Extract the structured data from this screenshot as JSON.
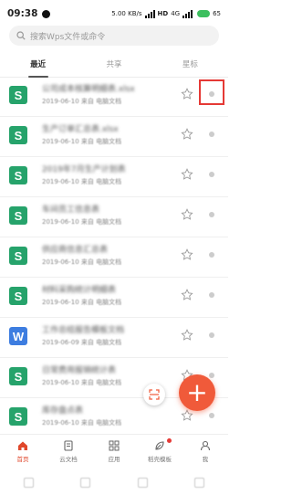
{
  "status_bar": {
    "time": "09:38",
    "network": "5.00 KB/s",
    "hd": "HD",
    "indicator": "4G",
    "battery": "65"
  },
  "search": {
    "placeholder": "搜索Wps文件或命令"
  },
  "tabs": [
    {
      "label": "最近",
      "active": true
    },
    {
      "label": "共享",
      "active": false
    },
    {
      "label": "星标",
      "active": false
    }
  ],
  "files": [
    {
      "type": "S",
      "name": "公司成本核算明细表.xlsx",
      "date": "2019-06-10",
      "meta": "来自 电脑文档"
    },
    {
      "type": "S",
      "name": "生产订单汇总表.xlsx",
      "date": "2019-06-10",
      "meta": "来自 电脑文档"
    },
    {
      "type": "S",
      "name": "2019年7月生产计划表",
      "date": "2019-06-10",
      "meta": "来自 电脑文档"
    },
    {
      "type": "S",
      "name": "车间员工信息表",
      "date": "2019-06-10",
      "meta": "来自 电脑文档"
    },
    {
      "type": "S",
      "name": "供应商信息汇总表",
      "date": "2019-06-10",
      "meta": "来自 电脑文档"
    },
    {
      "type": "S",
      "name": "材料采购统计明细表",
      "date": "2019-06-10",
      "meta": "来自 电脑文档"
    },
    {
      "type": "W",
      "name": "工作总结报告模板文档",
      "date": "2019-06-09",
      "meta": "来自 电脑文档"
    },
    {
      "type": "S",
      "name": "日常费用报销统计表",
      "date": "2019-06-10",
      "meta": "来自 电脑文档"
    },
    {
      "type": "S",
      "name": "库存盘点表",
      "date": "2019-06-10",
      "meta": "来自 电脑文档"
    }
  ],
  "bottom_nav": [
    {
      "label": "首页",
      "icon": "home-icon",
      "active": true
    },
    {
      "label": "云文档",
      "icon": "cloud-doc-icon",
      "active": false
    },
    {
      "label": "应用",
      "icon": "apps-icon",
      "active": false
    },
    {
      "label": "稻壳模板",
      "icon": "template-icon",
      "active": false
    },
    {
      "label": "我",
      "icon": "user-icon",
      "active": false
    }
  ],
  "colors": {
    "spreadsheet": "#26a36b",
    "writer": "#3d7de0",
    "accent": "#f05a3a",
    "highlight": "#e53935"
  }
}
